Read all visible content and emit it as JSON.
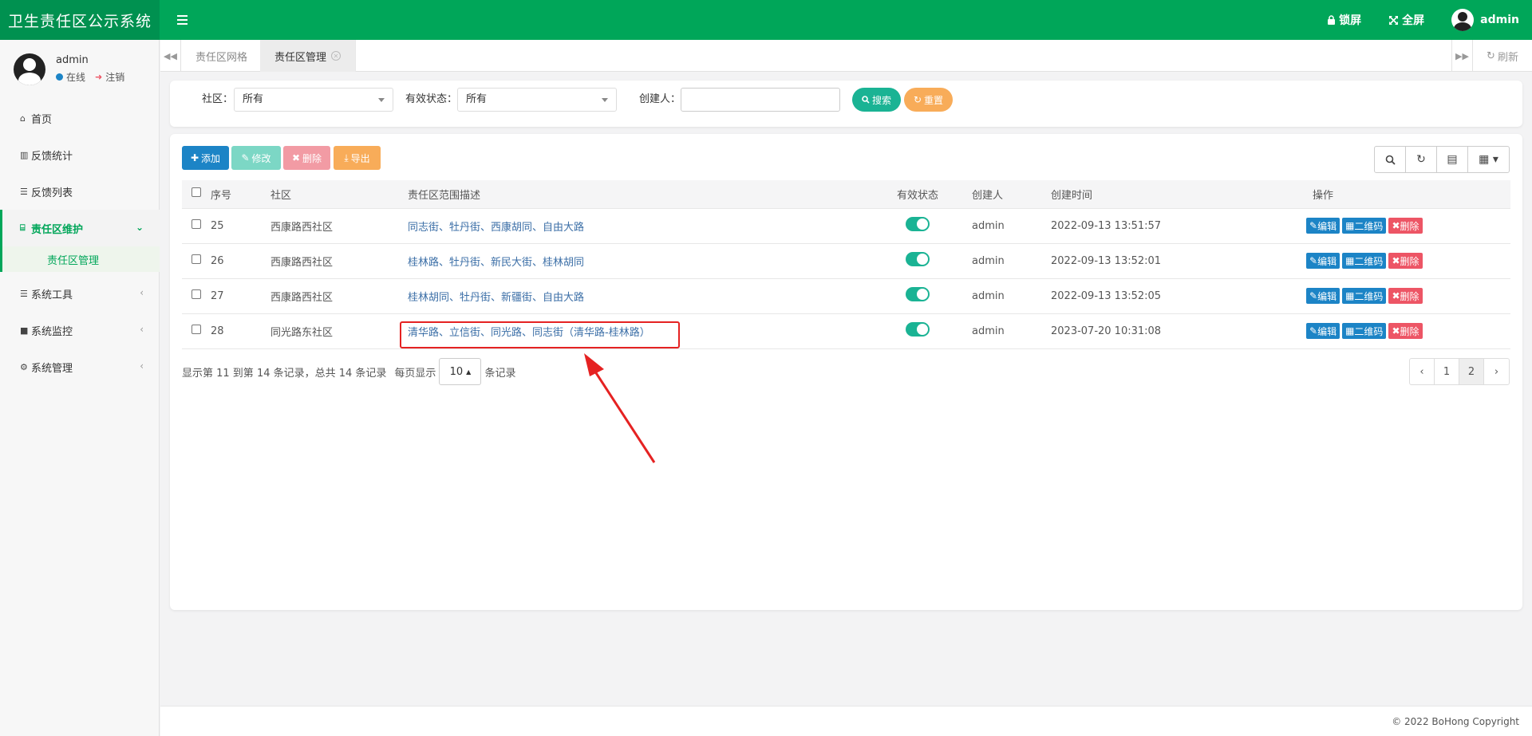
{
  "app": {
    "title": "卫生责任区公示系统"
  },
  "header": {
    "lock": "锁屏",
    "fullscreen": "全屏",
    "user": "admin"
  },
  "sidebar": {
    "user": {
      "name": "admin",
      "status": "在线",
      "logout": "注销"
    },
    "items": [
      {
        "label": "首页",
        "icon": "home-icon"
      },
      {
        "label": "反馈统计",
        "icon": "bar-chart-icon"
      },
      {
        "label": "反馈列表",
        "icon": "list-icon"
      },
      {
        "label": "责任区维护",
        "icon": "institution-icon",
        "active": true
      },
      {
        "label": "责任区管理",
        "sub": true
      },
      {
        "label": "系统工具",
        "icon": "list-icon"
      },
      {
        "label": "系统监控",
        "icon": "video-icon"
      },
      {
        "label": "系统管理",
        "icon": "gear-icon"
      }
    ]
  },
  "tabs": [
    {
      "label": "责任区网格"
    },
    {
      "label": "责任区管理",
      "active": true
    }
  ],
  "tabs_refresh": "刷新",
  "search": {
    "community_label": "社区：",
    "community_value": "所有",
    "status_label": "有效状态：",
    "status_value": "所有",
    "creator_label": "创建人：",
    "creator_value": "",
    "search_btn": "搜索",
    "reset_btn": "重置"
  },
  "toolbar": {
    "add": "添加",
    "edit": "修改",
    "delete": "删除",
    "export": "导出"
  },
  "table": {
    "headers": [
      "序号",
      "社区",
      "责任区范围描述",
      "有效状态",
      "创建人",
      "创建时间",
      "操作"
    ],
    "rows": [
      {
        "id": "25",
        "community": "西康路西社区",
        "desc": "同志街、牡丹街、西康胡同、自由大路",
        "creator": "admin",
        "time": "2022-09-13 13:51:57"
      },
      {
        "id": "26",
        "community": "西康路西社区",
        "desc": "桂林路、牡丹街、新民大街、桂林胡同",
        "creator": "admin",
        "time": "2022-09-13 13:52:01"
      },
      {
        "id": "27",
        "community": "西康路西社区",
        "desc": "桂林胡同、牡丹街、新疆街、自由大路",
        "creator": "admin",
        "time": "2022-09-13 13:52:05"
      },
      {
        "id": "28",
        "community": "同光路东社区",
        "desc": "清华路、立信街、同光路、同志街（清华路-桂林路）",
        "creator": "admin",
        "time": "2023-07-20 10:31:08"
      }
    ],
    "actions": {
      "edit": "编辑",
      "qr": "二维码",
      "del": "删除"
    }
  },
  "pager": {
    "info": "显示第 11 到第 14 条记录，总共 14 条记录",
    "per_page_label": "每页显示",
    "page_size": "10",
    "per_page_suffix": "条记录",
    "prev": "‹",
    "pages": [
      "1",
      "2"
    ],
    "next": "›",
    "current_page": 2
  },
  "footer": {
    "copyright": "© 2022 BoHong Copyright"
  },
  "colors": {
    "brand": "#00a659",
    "primary": "#1c84c6",
    "danger": "#ed5565",
    "toggle": "#1ab394",
    "annotation": "#e52222"
  }
}
